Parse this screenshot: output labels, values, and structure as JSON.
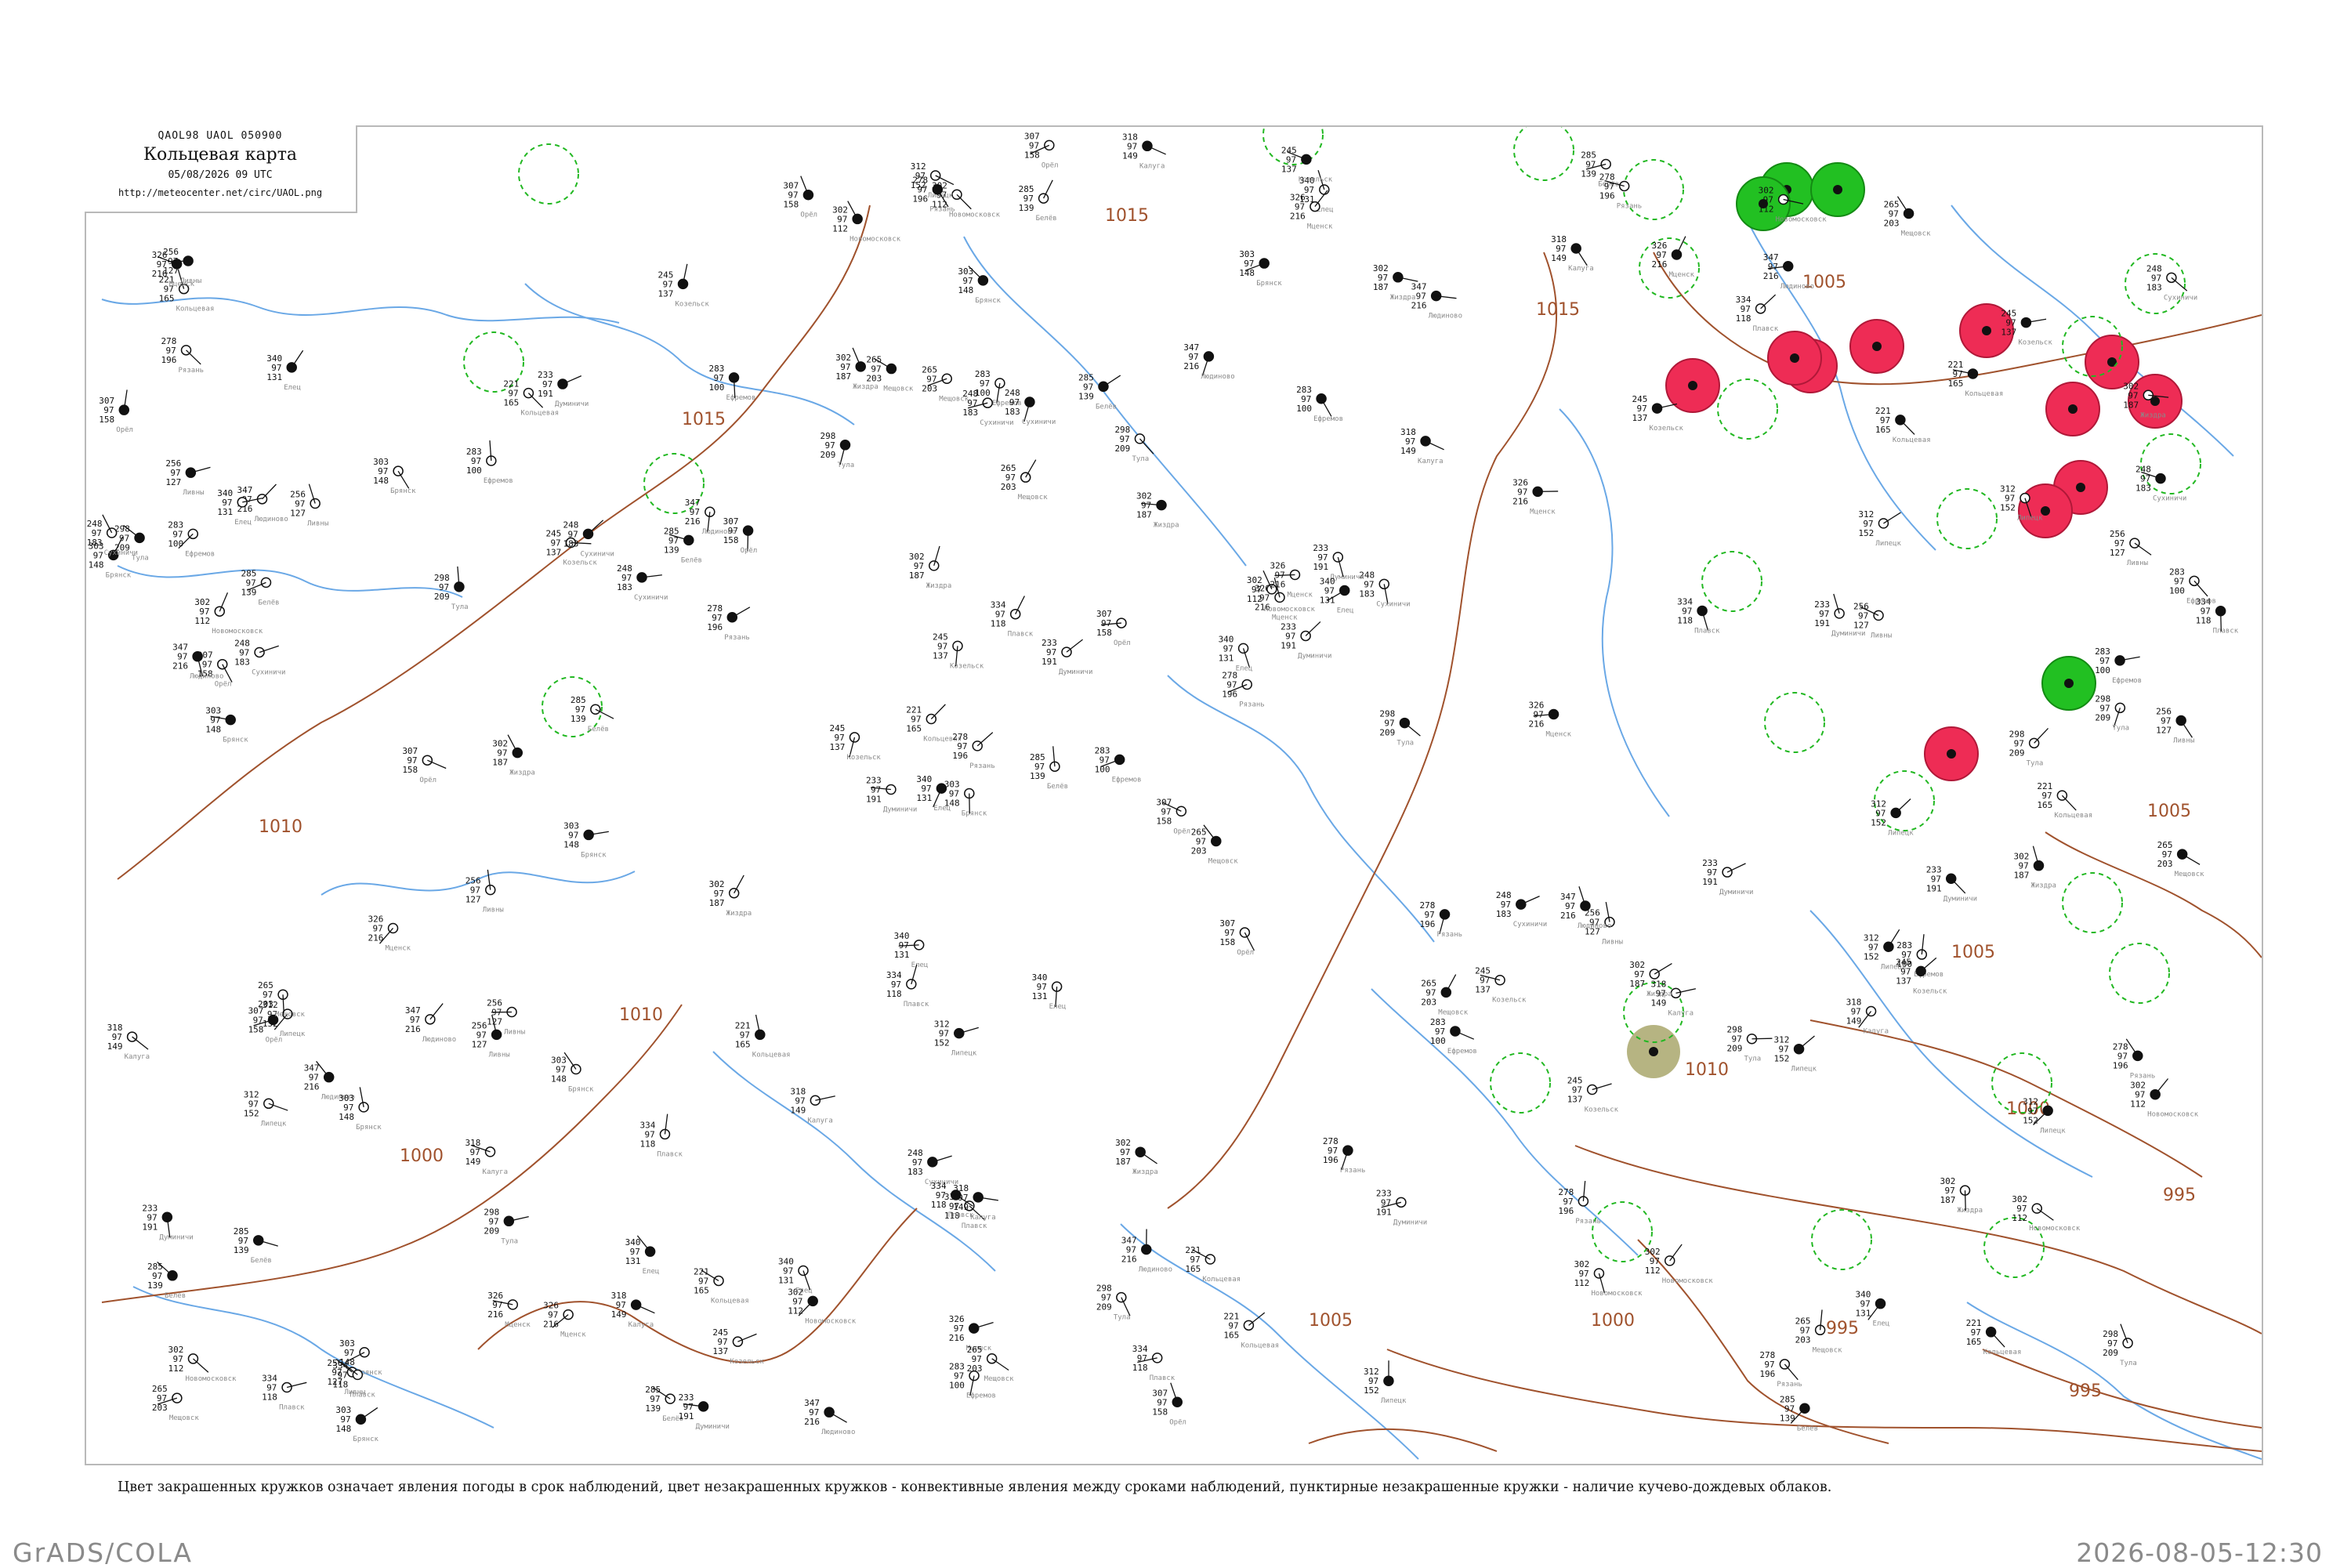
{
  "header": {
    "code": "QAOL98  UAOL  050900",
    "title": "Кольцевая карта",
    "datetime": "05/08/2026 09 UTC",
    "url": "http://meteocenter.net/circ/UAOL.png"
  },
  "caption": "Цвет закрашенных кружков означает явления погоды в срок наблюдений, цвет незакрашенных кружков - конвективные явления между сроками наблюдений, пунктирные незакрашенные кружки - наличие кучево-дождевых облаков.",
  "footer": {
    "left": "GrADS/COLA",
    "right": "2026-08-05-12:30"
  },
  "colors": {
    "isobar": "#a0522d",
    "water": "#6aa8e6",
    "rain_fill": "#ee2c55",
    "shower_fill": "#22c022",
    "fog_fill": "#b6b482",
    "cb_dashed": "#22b822",
    "caption_text": "#111111",
    "footer_text": "#8a8a8a"
  },
  "isobar_labels": [
    "1015",
    "1015",
    "1010",
    "1010",
    "1005",
    "1005",
    "1005",
    "1005",
    "1000",
    "1000",
    "1000",
    "995",
    "995",
    "995",
    "1015",
    "1010"
  ],
  "markers": {
    "rain_filled": 11,
    "shower_filled": 4,
    "fog_filled": 1
  },
  "stations": [
    {
      "name": "Кольцевая",
      "t": "221",
      "p": "165"
    },
    {
      "name": "Сухиничи",
      "t": "248",
      "p": "183"
    },
    {
      "name": "Козельск",
      "t": "245",
      "p": "137"
    },
    {
      "name": "Думиничи",
      "t": "233",
      "p": "191"
    },
    {
      "name": "Калуга",
      "t": "318",
      "p": "149"
    },
    {
      "name": "Брянск",
      "t": "303",
      "p": "148"
    },
    {
      "name": "Мещовск",
      "t": "265",
      "p": "203"
    },
    {
      "name": "Жиздра",
      "t": "302",
      "p": "187"
    },
    {
      "name": "Людиново",
      "t": "347",
      "p": "216"
    },
    {
      "name": "Орёл",
      "t": "307",
      "p": "158"
    },
    {
      "name": "Белёв",
      "t": "285",
      "p": "139"
    },
    {
      "name": "Тула",
      "t": "298",
      "p": "209"
    },
    {
      "name": "Ефремов",
      "t": "283",
      "p": "100"
    },
    {
      "name": "Мценск",
      "t": "326",
      "p": "216"
    },
    {
      "name": "Ливны",
      "t": "256",
      "p": "127"
    },
    {
      "name": "Елец",
      "t": "340",
      "p": "131"
    },
    {
      "name": "Новомосковск",
      "t": "302",
      "p": "112"
    },
    {
      "name": "Плавск",
      "t": "334",
      "p": "118"
    },
    {
      "name": "Рязань",
      "t": "278",
      "p": "196"
    },
    {
      "name": "Липецк",
      "t": "312",
      "p": "152"
    }
  ]
}
